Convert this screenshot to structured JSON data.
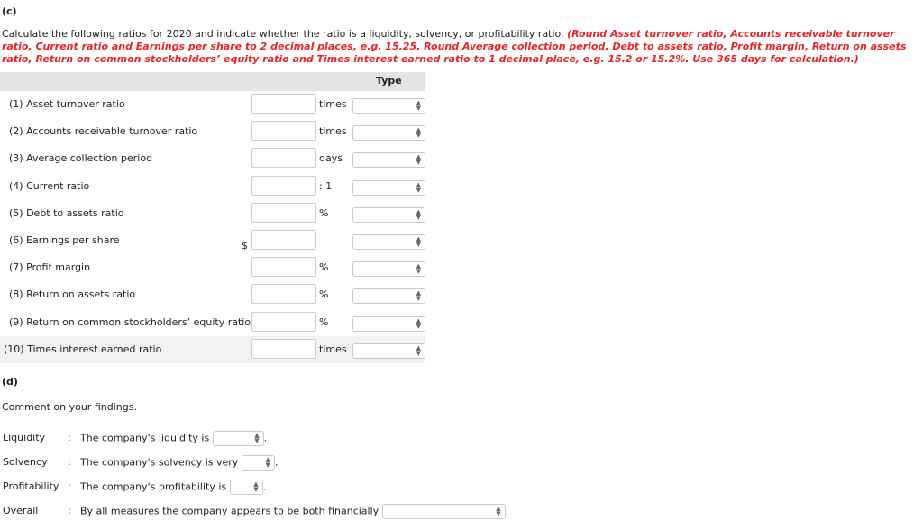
{
  "part_c": {
    "heading": "(c)",
    "instruction": "Calculate the following ratios for 2020 and indicate whether the ratio is a liquidity, solvency, or profitability ratio.",
    "instruction_red": "(Round Asset turnover ratio, Accounts receivable turnover ratio, Current ratio and Earnings per share to 2 decimal places, e.g. 15.25. Round Average collection period, Debt to assets ratio, Profit margin, Return on assets ratio, Return on common stockholders’ equity ratio and Times interest earned ratio to 1 decimal place, e.g. 15.2 or 15.2%. Use 365 days for calculation.)",
    "type_header": "Type",
    "rows": [
      {
        "label": "(1) Asset turnover ratio",
        "prefix": "",
        "unit": "times",
        "value": "",
        "type": ""
      },
      {
        "label": "(2) Accounts receivable turnover ratio",
        "prefix": "",
        "unit": "times",
        "value": "",
        "type": ""
      },
      {
        "label": "(3) Average collection period",
        "prefix": "",
        "unit": "days",
        "value": "",
        "type": ""
      },
      {
        "label": "(4) Current ratio",
        "prefix": "",
        "unit": ": 1",
        "value": "",
        "type": ""
      },
      {
        "label": "(5) Debt to assets ratio",
        "prefix": "",
        "unit": "%",
        "value": "",
        "type": ""
      },
      {
        "label": "(6) Earnings per share",
        "prefix": "$",
        "unit": "",
        "value": "",
        "type": ""
      },
      {
        "label": "(7) Profit margin",
        "prefix": "",
        "unit": "%",
        "value": "",
        "type": ""
      },
      {
        "label": "(8) Return on assets ratio",
        "prefix": "",
        "unit": "%",
        "value": "",
        "type": ""
      },
      {
        "label": "(9) Return on common stockholders’ equity ratio",
        "prefix": "",
        "unit": "%",
        "value": "",
        "type": ""
      },
      {
        "label": "(10) Times interest earned ratio",
        "prefix": "",
        "unit": "times",
        "value": "",
        "type": ""
      }
    ]
  },
  "part_d": {
    "heading": "(d)",
    "prompt": "Comment on your findings.",
    "rows": [
      {
        "label": "Liquidity",
        "colon": ":",
        "text": "The company's liquidity is",
        "end": "."
      },
      {
        "label": "Solvency",
        "colon": ":",
        "text": "The company's solvency is very",
        "end": "."
      },
      {
        "label": "Profitability",
        "colon": ":",
        "text": "The company's profitability is",
        "end": "."
      },
      {
        "label": "Overall",
        "colon": ":",
        "text": "By all measures the company appears to be both financially",
        "end": "."
      }
    ]
  }
}
